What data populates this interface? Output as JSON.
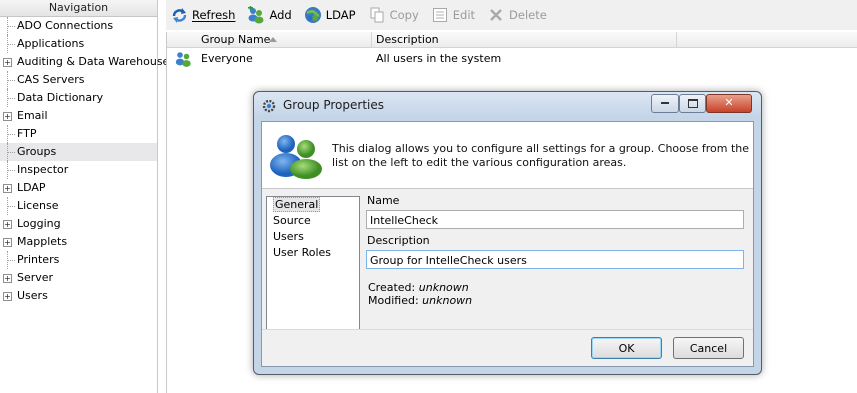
{
  "nav": {
    "header": "Navigation",
    "items": [
      {
        "label": "ADO Connections",
        "expandable": false
      },
      {
        "label": "Applications",
        "expandable": false
      },
      {
        "label": "Auditing & Data Warehouse",
        "expandable": true
      },
      {
        "label": "CAS Servers",
        "expandable": false
      },
      {
        "label": "Data Dictionary",
        "expandable": false
      },
      {
        "label": "Email",
        "expandable": true
      },
      {
        "label": "FTP",
        "expandable": false
      },
      {
        "label": "Groups",
        "expandable": false,
        "selected": true
      },
      {
        "label": "Inspector",
        "expandable": false
      },
      {
        "label": "LDAP",
        "expandable": true
      },
      {
        "label": "License",
        "expandable": false
      },
      {
        "label": "Logging",
        "expandable": true
      },
      {
        "label": "Mapplets",
        "expandable": true
      },
      {
        "label": "Printers",
        "expandable": false
      },
      {
        "label": "Server",
        "expandable": true
      },
      {
        "label": "Users",
        "expandable": true
      }
    ]
  },
  "toolbar": {
    "refresh_label": "Refresh",
    "add_label": "Add",
    "ldap_label": "LDAP",
    "copy_label": "Copy",
    "edit_label": "Edit",
    "delete_label": "Delete"
  },
  "grid": {
    "columns": [
      "Group Name",
      "Description"
    ],
    "rows": [
      {
        "name": "Everyone",
        "description": "All users in the system"
      }
    ]
  },
  "dialog": {
    "title": "Group Properties",
    "banner": "This dialog allows you to configure all settings for a group.  Choose from the list on the left to edit the various configuration areas.",
    "config_items": [
      "General",
      "Source",
      "Users",
      "User Roles"
    ],
    "name_label": "Name",
    "name_value": "IntelleCheck",
    "description_label": "Description",
    "description_value": "Group for IntelleCheck users",
    "created_label": "Created:",
    "created_value": "unknown",
    "modified_label": "Modified:",
    "modified_value": "unknown",
    "ok_label": "OK",
    "cancel_label": "Cancel"
  },
  "colors": {
    "dialog_frame": "#c5d5e8",
    "selection": "#e8e8ea",
    "focus_border": "#7eb4ea"
  }
}
